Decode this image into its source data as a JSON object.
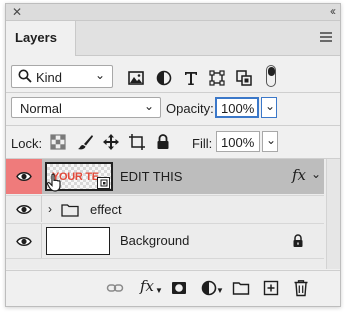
{
  "panel": {
    "title": "Layers",
    "close_icon": "close-icon",
    "collapse_icon": "collapse-double-chevron-icon",
    "menu_icon": "panel-menu-icon"
  },
  "filter": {
    "kind_label": "Kind",
    "icons": [
      "pixel-filter-icon",
      "adjustment-filter-icon",
      "type-filter-icon",
      "shape-filter-icon",
      "smart-object-filter-icon"
    ],
    "toggle_state": "on"
  },
  "blend": {
    "mode": "Normal",
    "opacity_label": "Opacity:",
    "opacity_value": "100%"
  },
  "lock": {
    "label": "Lock:",
    "fill_label": "Fill:",
    "fill_value": "100%"
  },
  "layers": [
    {
      "name": "EDIT THIS",
      "thumb_text": "YOUR TE",
      "selected": true,
      "has_fx": true,
      "type": "smart-object"
    },
    {
      "name": "effect",
      "type": "group",
      "expanded": false
    },
    {
      "name": "Background",
      "type": "pixel",
      "locked": true
    }
  ],
  "colors": {
    "selected_eye_bg": "#ef7b7b",
    "selected_row_bg": "#bdbdbd",
    "focus_border": "#3b78c9",
    "thumb_text": "#e34a3a"
  },
  "bottom_toolbar": {
    "fx_label": "fx"
  }
}
